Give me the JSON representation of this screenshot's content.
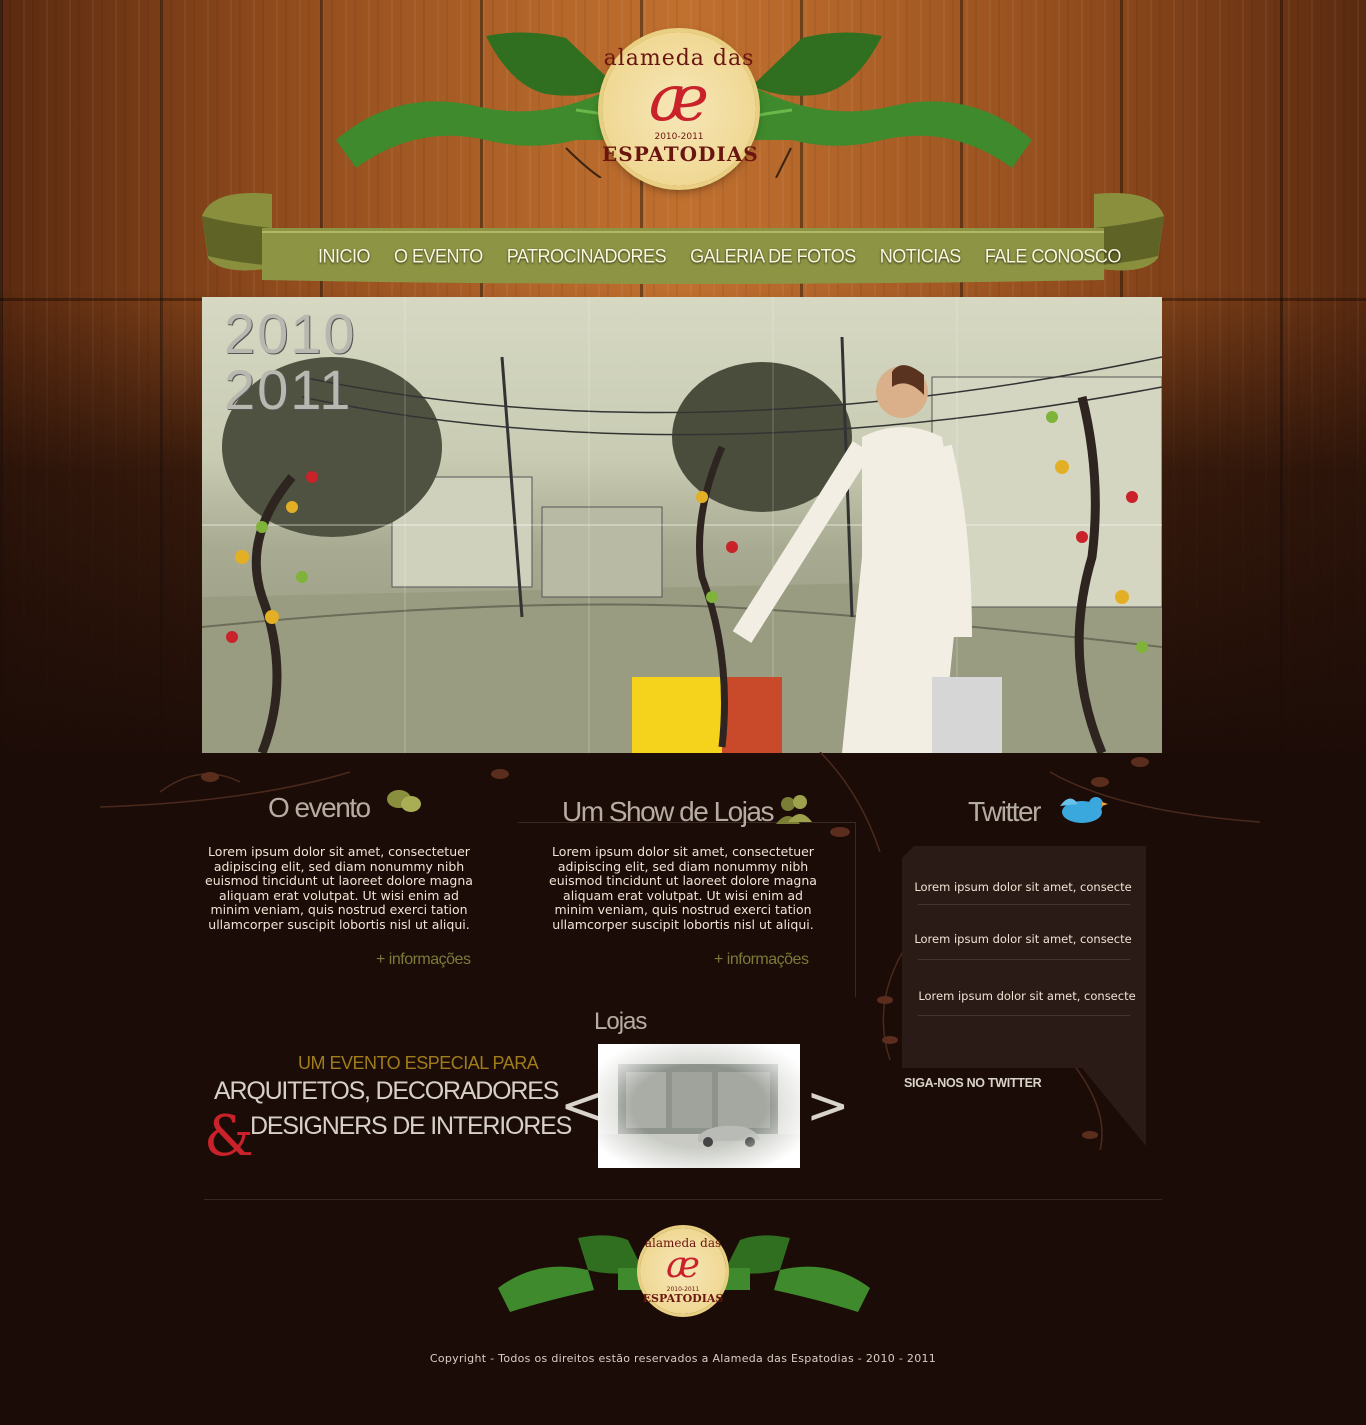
{
  "brand": {
    "logo_top": "alameda das",
    "logo_mark": "æ",
    "logo_years": "2010-2011",
    "logo_bottom": "ESPATODIAS"
  },
  "nav": {
    "items": [
      "INICIO",
      "O EVENTO",
      "PATROCINADORES",
      "GALERIA DE FOTOS",
      "NOTICIAS",
      "FALE CONOSCO"
    ]
  },
  "hero": {
    "year_top": "2010",
    "year_bottom": "2011"
  },
  "evento": {
    "title": "O evento",
    "text": "Lorem ipsum dolor sit amet, consectetuer adipiscing elit, sed diam nonummy nibh euismod tincidunt ut laoreet dolore magna aliquam erat volutpat. Ut wisi enim ad minim veniam, quis nostrud exerci tation ullamcorper suscipit lobortis nisl ut aliqui.",
    "more": "+ informações"
  },
  "show": {
    "title": "Um Show de Lojas",
    "text": "Lorem ipsum dolor sit amet, consectetuer adipiscing elit, sed diam nonummy nibh euismod tincidunt ut laoreet dolore magna aliquam erat volutpat. Ut wisi enim ad minim veniam, quis nostrud exerci tation ullamcorper suscipit lobortis nisl ut aliqui.",
    "more": "+ informações"
  },
  "twitter": {
    "title": "Twitter",
    "tweets": [
      "Lorem ipsum dolor sit amet, consecte",
      "Lorem ipsum dolor sit amet, consecte",
      "Lorem ipsum dolor sit amet, consecte"
    ],
    "follow": "SIGA-NOS NO TWITTER"
  },
  "tagline": {
    "line1": "UM EVENTO ESPECIAL PARA",
    "line2": "ARQUITETOS, DECORADORES",
    "amp": "&",
    "line3": "DESIGNERS DE INTERIORES"
  },
  "lojas": {
    "title": "Lojas",
    "prev": "<",
    "next": ">"
  },
  "footer": {
    "copyright": "Copyright - Todos os direitos estão reservados a Alameda das Espatodias - 2010 - 2011"
  },
  "colors": {
    "ribbon_green": "#3f8a2c",
    "nav_olive": "#8a8f3e",
    "logo_red": "#c9222a",
    "badge_cream": "#f3dea0",
    "background": "#1c0c07"
  }
}
